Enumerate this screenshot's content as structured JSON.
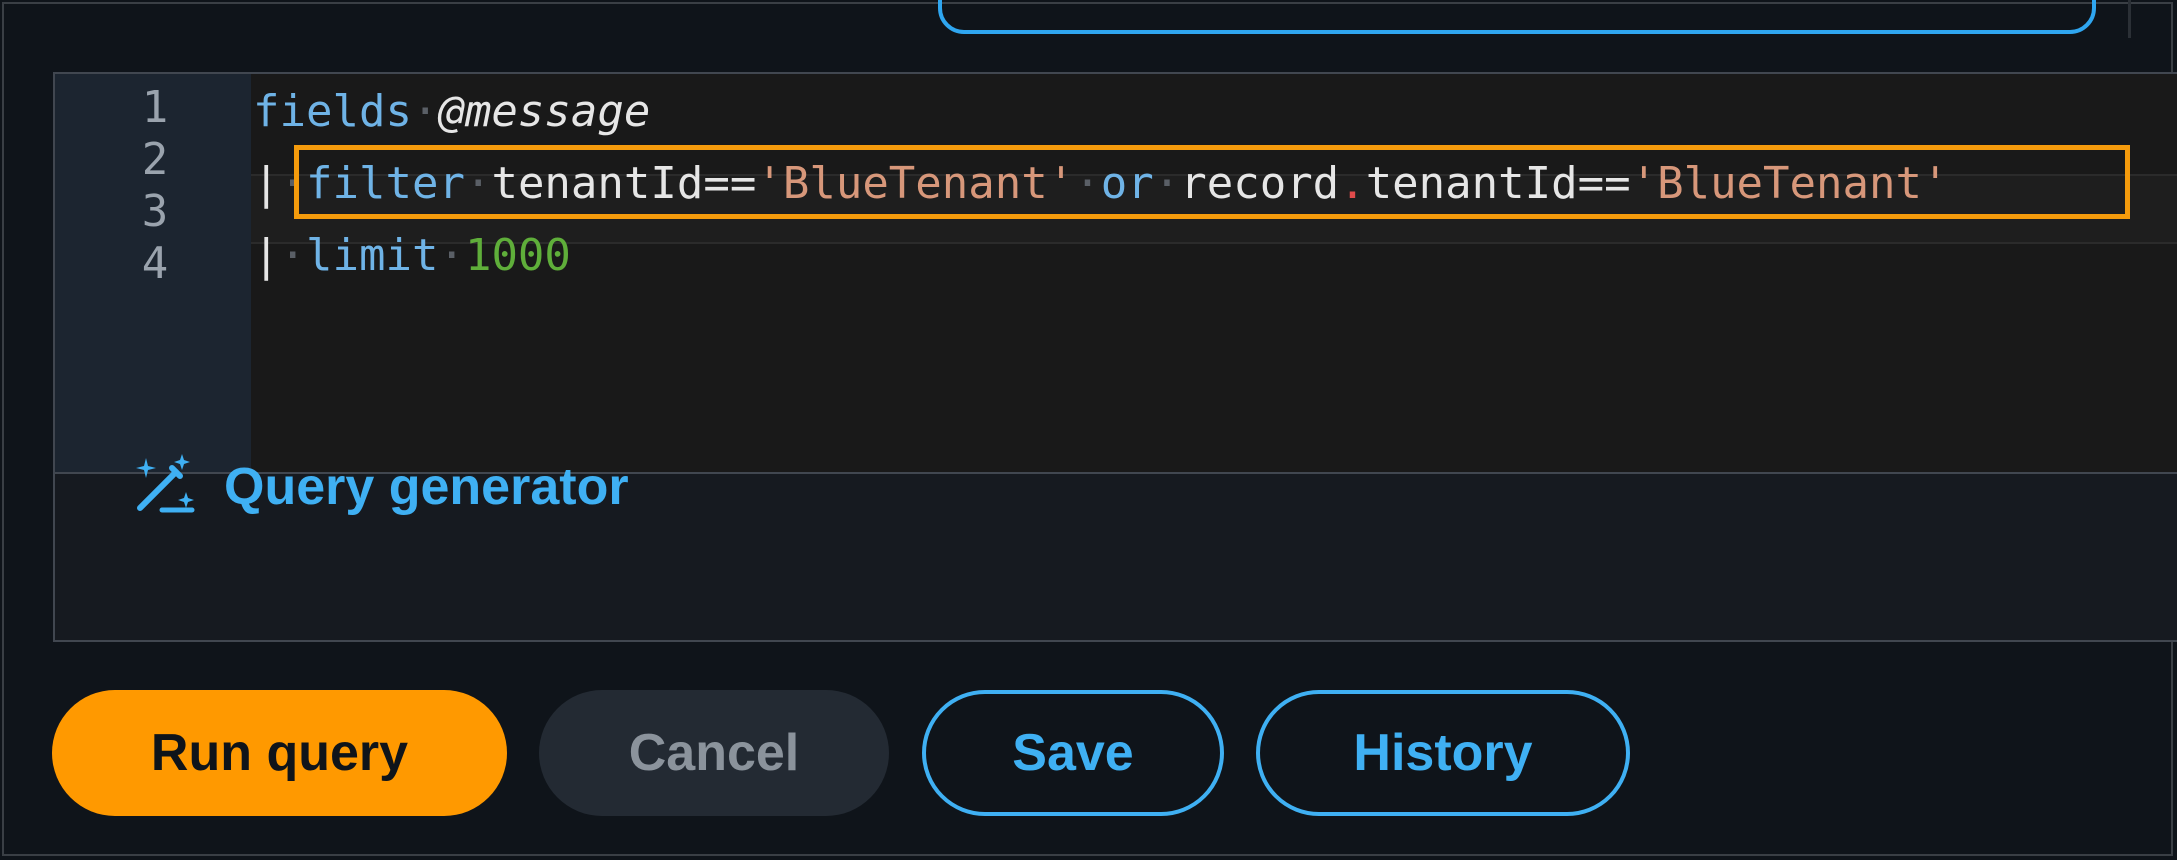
{
  "editor": {
    "line_numbers": [
      "1",
      "2",
      "3",
      "4"
    ],
    "lines": [
      {
        "tokens": [
          {
            "t": "fields",
            "c": "kw"
          },
          {
            "t": "·",
            "c": "ws"
          },
          {
            "t": "@message",
            "c": "at"
          }
        ]
      },
      {
        "tokens": [
          {
            "t": "|",
            "c": "pipe"
          },
          {
            "t": "·",
            "c": "ws"
          },
          {
            "t": "filter",
            "c": "kw"
          },
          {
            "t": "·",
            "c": "ws"
          },
          {
            "t": "tenantId==",
            "c": "ident"
          },
          {
            "t": "'BlueTenant'",
            "c": "str"
          },
          {
            "t": "·",
            "c": "ws"
          },
          {
            "t": "or",
            "c": "kw"
          },
          {
            "t": "·",
            "c": "ws"
          },
          {
            "t": "record",
            "c": "ident"
          },
          {
            "t": ".",
            "c": "dot"
          },
          {
            "t": "tenantId==",
            "c": "ident"
          },
          {
            "t": "'BlueTenant'",
            "c": "str"
          }
        ]
      },
      {
        "tokens": [
          {
            "t": "|",
            "c": "pipe"
          },
          {
            "t": "·",
            "c": "ws"
          },
          {
            "t": "limit",
            "c": "kw"
          },
          {
            "t": "·",
            "c": "ws"
          },
          {
            "t": "1000",
            "c": "num"
          }
        ]
      },
      {
        "tokens": []
      }
    ]
  },
  "query_generator": {
    "label": "Query generator",
    "icon": "magic-wand-icon"
  },
  "actions": {
    "run_label": "Run query",
    "cancel_label": "Cancel",
    "save_label": "Save",
    "history_label": "History"
  },
  "colors": {
    "accent": "#3fb0f3",
    "primary_button": "#ff9900",
    "highlight_border": "#f59b0c"
  }
}
